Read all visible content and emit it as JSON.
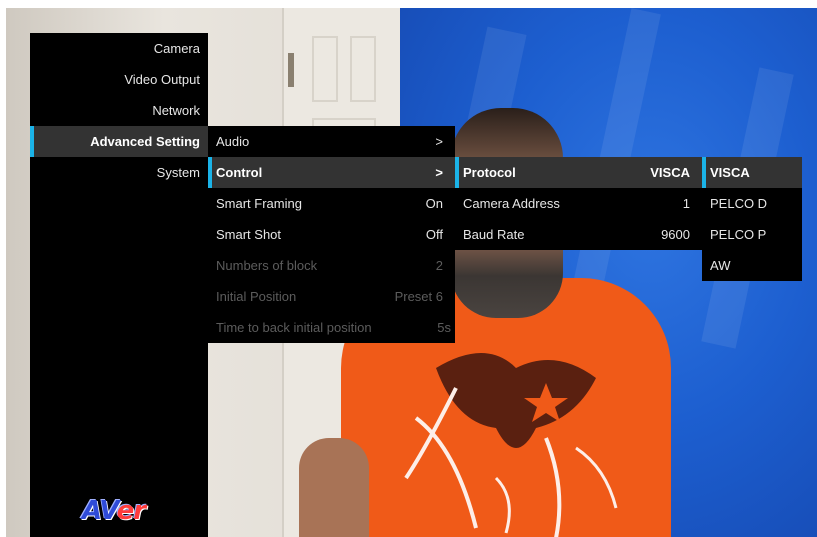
{
  "main_menu": {
    "items": [
      {
        "label": "Camera"
      },
      {
        "label": "Video Output"
      },
      {
        "label": "Network"
      },
      {
        "label": "Advanced Setting"
      },
      {
        "label": "System"
      }
    ]
  },
  "advanced_menu": {
    "items": [
      {
        "label": "Audio",
        "value": ">"
      },
      {
        "label": "Control",
        "value": ">"
      },
      {
        "label": "Smart Framing",
        "value": "On"
      },
      {
        "label": "Smart Shot",
        "value": "Off"
      },
      {
        "label": "Numbers of block",
        "value": "2"
      },
      {
        "label": "Initial Position",
        "value": "Preset 6"
      },
      {
        "label": "Time to back initial position",
        "value": "5s"
      }
    ]
  },
  "control_menu": {
    "items": [
      {
        "label": "Protocol",
        "value": "VISCA"
      },
      {
        "label": "Camera Address",
        "value": "1"
      },
      {
        "label": "Baud Rate",
        "value": "9600"
      }
    ]
  },
  "protocol_options": {
    "items": [
      "VISCA",
      "PELCO D",
      "PELCO P",
      "AW"
    ],
    "selected": "VISCA"
  },
  "logo": {
    "part1": "AV",
    "part2": "er"
  },
  "colors": {
    "highlight_bar": "#1bb3e8",
    "menu_bg": "#000000",
    "selected_bg": "#333333",
    "disabled_text": "#5c5c5c"
  }
}
